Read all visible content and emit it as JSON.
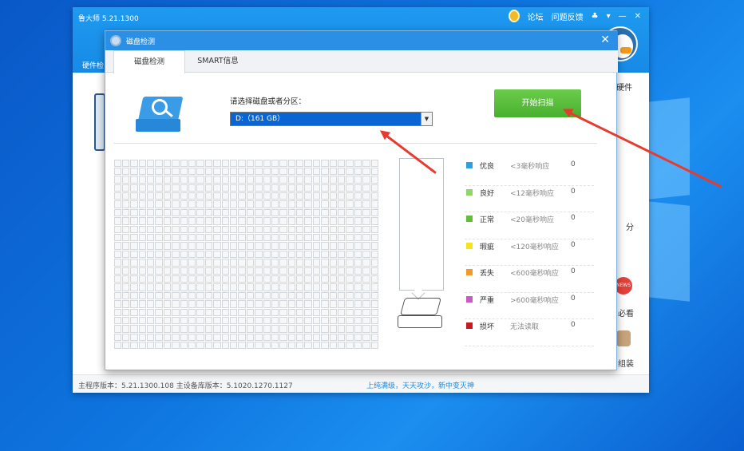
{
  "app": {
    "title": "鲁大师 5.21.1300",
    "tools": [
      "论坛",
      "问题反馈"
    ],
    "left_label": "硬件检",
    "right_items": [
      "硬件",
      "分",
      "必看",
      "组装"
    ]
  },
  "statusbar": {
    "left": "主程序版本：5.21.1300.108  主设备库版本：5.1020.1270.1127",
    "mid": "上纯满级，天天攻沙，新中变灭神"
  },
  "dialog": {
    "title": "磁盘检测",
    "tabs": [
      {
        "label": "磁盘检测",
        "active": true
      },
      {
        "label": "SMART信息",
        "active": false
      }
    ],
    "select_label": "请选择磁盘或者分区：",
    "select_value": "D:（161 GB）",
    "scan_button": "开始扫描",
    "legend": [
      {
        "name": "优良",
        "range": "<3毫秒响应",
        "count": "0",
        "color": "#2f9fe4"
      },
      {
        "name": "良好",
        "range": "<12毫秒响应",
        "count": "0",
        "color": "#8fd56a"
      },
      {
        "name": "正常",
        "range": "<20毫秒响应",
        "count": "0",
        "color": "#5fbf3a"
      },
      {
        "name": "瑕疵",
        "range": "<120毫秒响应",
        "count": "0",
        "color": "#f5e31c"
      },
      {
        "name": "丢失",
        "range": "<600毫秒响应",
        "count": "0",
        "color": "#f29b2a"
      },
      {
        "name": "严重",
        "range": ">600毫秒响应",
        "count": "0",
        "color": "#c95bc5"
      },
      {
        "name": "损坏",
        "range": "无法读取",
        "count": "0",
        "color": "#c8191f"
      }
    ]
  }
}
